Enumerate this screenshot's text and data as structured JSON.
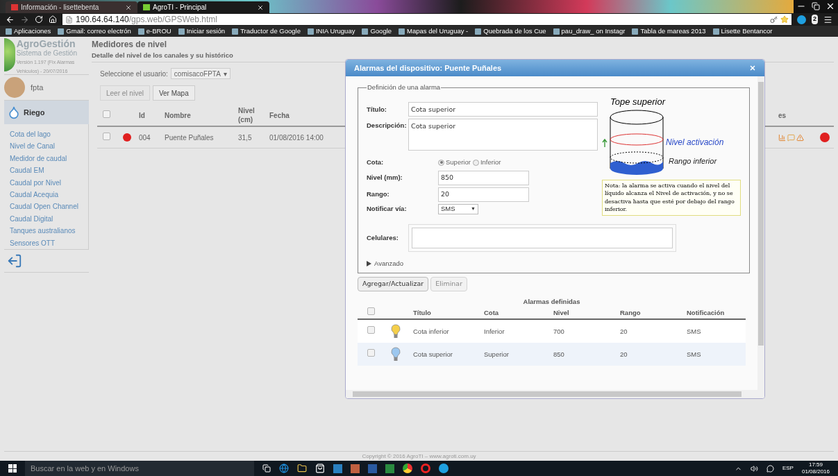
{
  "browser": {
    "tabs": [
      {
        "title": "Información - lisettebenta",
        "selected": false
      },
      {
        "title": "AgroTI - Principal",
        "selected": true
      }
    ],
    "address": {
      "host": "190.64.64.140",
      "path": "/gps.web/GPSWeb.html"
    },
    "extension_badge": "2",
    "bookmarks": [
      "Aplicaciones",
      "Gmail: correo electrón",
      "e-BROU",
      "Iniciar sesión",
      "Traductor de Google",
      "INIA Uruguay",
      "Google",
      "Mapas del Uruguay -",
      "Quebrada de los Cue",
      "pau_draw_ on Instagr",
      "Tabla de mareas 2013",
      "Lisette Bentancor"
    ]
  },
  "sidebar": {
    "brand": "AgroGestión",
    "subtitle": "Sistema de Gestión",
    "version": "Versión 1.197 (Fix Alarmas Vehiculos) - 20/07/2016",
    "user": "fpta",
    "section": "Riego",
    "items": [
      "Cota del lago",
      "Nivel de Canal",
      "Medidor de caudal",
      "Caudal EM",
      "Caudal por Nivel",
      "Caudal Acequia",
      "Caudal Open Channel",
      "Caudal Digital",
      "Tanques australianos",
      "Sensores OTT"
    ]
  },
  "main": {
    "title": "Medidores de nivel",
    "subtitle": "Detalle del nivel de los canales y su histórico",
    "user_label": "Seleccione el usuario:",
    "user_value": "comisacoFPTA",
    "buttons": [
      {
        "label": "Leer el nivel",
        "disabled": true
      },
      {
        "label": "Ver Mapa",
        "disabled": false
      }
    ],
    "user_caret": "▾",
    "select_all_checked": false,
    "columns": [
      "Id",
      "Nombre",
      "Nivel (cm)",
      "Fecha"
    ],
    "column_cut": "es",
    "rows": [
      {
        "checked": false,
        "color": "#e02020",
        "id": "004",
        "name": "Puente Puñales",
        "level": "31,5",
        "date": "01/08/2016 14:00"
      }
    ]
  },
  "footer": {
    "copyright": "Copyright © 2016 AgroTI – www.agroti.com.uy"
  },
  "dialog": {
    "title": "Alarmas del dispositivo: Puente Puñales",
    "legend": "Definición de una alarma",
    "fields": {
      "titulo_label": "Título:",
      "titulo": "Cota superior",
      "descripcion_label": "Descripción:",
      "descripcion": "Cota superior",
      "cota_label": "Cota:",
      "nivel_label": "Nivel (mm):",
      "nivel": "850",
      "rango_label": "Rango:",
      "rango": "20",
      "notificar_label": "Notificar vía:",
      "notificar": "SMS",
      "notificar_caret": "▼",
      "celulares_label": "Celulares:"
    },
    "cota_options": [
      {
        "label": "Superior",
        "selected": true
      },
      {
        "label": "Inferior",
        "selected": false
      }
    ],
    "diagram": {
      "top": "Tope superior",
      "activation": "Nivel activación",
      "range": "Rango inferior"
    },
    "note": "Nota: la alarma se activa cuando el nivel del líquido alcanza el Nivel de activación, y no se desactiva hasta que esté por debajo del rango inferior.",
    "advanced": {
      "label": "Avanzado",
      "expanded": false
    },
    "buttons": [
      {
        "label": "Agregar/Actualizar",
        "disabled": false
      },
      {
        "label": "Eliminar",
        "disabled": true
      }
    ],
    "alarms_title": "Alarmas definidas",
    "select_all_checked": false,
    "columns": [
      "Título",
      "Cota",
      "Nivel",
      "Rango",
      "Notificación"
    ],
    "rows": [
      {
        "checked": false,
        "selected": false,
        "color": "#f5cf4a",
        "title": "Cota inferior",
        "cota": "Inferior",
        "nivel": "700",
        "rango": "20",
        "notificacion": "SMS"
      },
      {
        "checked": false,
        "selected": true,
        "color": "#9cc7ef",
        "title": "Cota superior",
        "cota": "Superior",
        "nivel": "850",
        "rango": "20",
        "notificacion": "SMS"
      }
    ]
  },
  "taskbar": {
    "search_placeholder": "Buscar en la web y en Windows",
    "language": "ESP",
    "time": "17:59",
    "date": "01/08/2016"
  }
}
